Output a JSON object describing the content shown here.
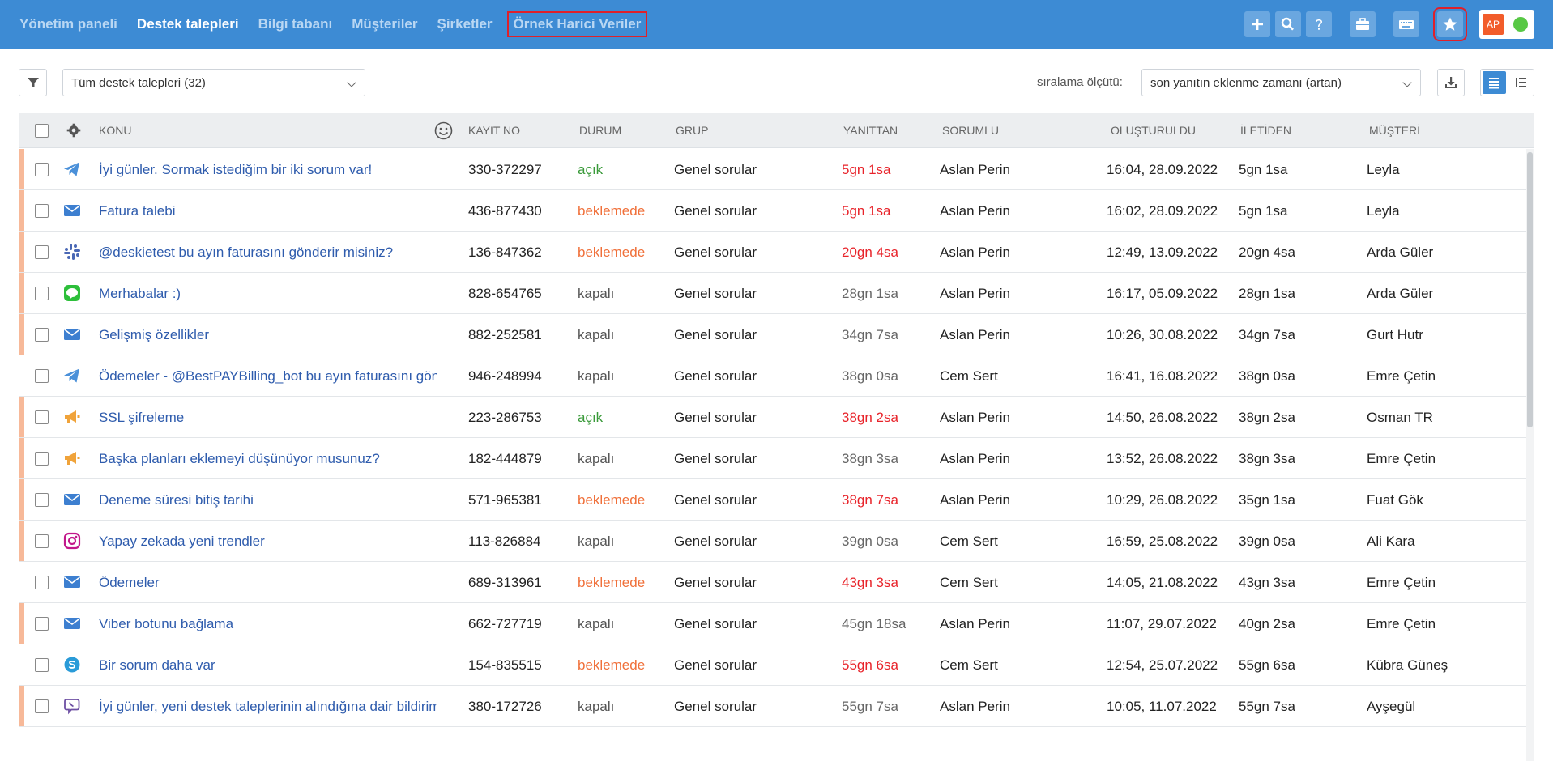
{
  "nav": {
    "items": [
      {
        "label": "Yönetim paneli",
        "active": false
      },
      {
        "label": "Destek talepleri",
        "active": true
      },
      {
        "label": "Bilgi tabanı",
        "active": false
      },
      {
        "label": "Müşteriler",
        "active": false
      },
      {
        "label": "Şirketler",
        "active": false
      },
      {
        "label": "Örnek Harici Veriler",
        "active": false,
        "highlighted": true
      }
    ]
  },
  "toolbar": {
    "icons": [
      "plus-icon",
      "search-icon",
      "help-icon",
      "briefcase-icon",
      "keyboard-icon",
      "star-icon"
    ],
    "avatar_initials": "AP",
    "online_color": "#58c845"
  },
  "filters": {
    "view_select": "Tüm destek talepleri (32)",
    "sort_label": "sıralama ölçütü:",
    "sort_select": "son yanıtın eklenme zamanı (artan)"
  },
  "table": {
    "headers": {
      "subject": "KONU",
      "id": "KAYIT NO",
      "status": "DURUM",
      "group": "GRUP",
      "reply": "YANITTAN",
      "assignee": "SORUMLU",
      "created": "OLUŞTURULDU",
      "fromMsg": "İLETİDEN",
      "customer": "MÜŞTERİ"
    },
    "rows": [
      {
        "channel": "telegram-icon",
        "accent": true,
        "subject": "İyi günler. Sormak istediğim bir iki sorum var!",
        "id": "330-372297",
        "status": "açık",
        "group": "Genel sorular",
        "reply": "5gn 1sa",
        "reply_overdue": true,
        "assignee": "Aslan Perin",
        "created": "16:04, 28.09.2022",
        "fromMsg": "5gn 1sa",
        "customer": "Leyla"
      },
      {
        "channel": "email-icon",
        "accent": true,
        "subject": "Fatura talebi",
        "id": "436-877430",
        "status": "beklemede",
        "group": "Genel sorular",
        "reply": "5gn 1sa",
        "reply_overdue": true,
        "assignee": "Aslan Perin",
        "created": "16:02, 28.09.2022",
        "fromMsg": "5gn 1sa",
        "customer": "Leyla"
      },
      {
        "channel": "slack-icon",
        "accent": true,
        "subject": "@deskietest bu ayın faturasını gönderir misiniz?",
        "id": "136-847362",
        "status": "beklemede",
        "group": "Genel sorular",
        "reply": "20gn 4sa",
        "reply_overdue": true,
        "assignee": "Aslan Perin",
        "created": "12:49, 13.09.2022",
        "fromMsg": "20gn 4sa",
        "customer": "Arda Güler"
      },
      {
        "channel": "line-icon",
        "accent": true,
        "subject": "Merhabalar :)",
        "id": "828-654765",
        "status": "kapalı",
        "group": "Genel sorular",
        "reply": "28gn 1sa",
        "reply_overdue": false,
        "assignee": "Aslan Perin",
        "created": "16:17, 05.09.2022",
        "fromMsg": "28gn 1sa",
        "customer": "Arda Güler"
      },
      {
        "channel": "email-icon",
        "accent": true,
        "subject": "Gelişmiş özellikler",
        "id": "882-252581",
        "status": "kapalı",
        "group": "Genel sorular",
        "reply": "34gn 7sa",
        "reply_overdue": false,
        "assignee": "Aslan Perin",
        "created": "10:26, 30.08.2022",
        "fromMsg": "34gn 7sa",
        "customer": "Gurt Hutr"
      },
      {
        "channel": "telegram-icon",
        "accent": false,
        "subject": "Ödemeler - @BestPAYBilling_bot bu ayın faturasını göndermedi",
        "id": "946-248994",
        "status": "kapalı",
        "group": "Genel sorular",
        "reply": "38gn 0sa",
        "reply_overdue": false,
        "assignee": "Cem Sert",
        "created": "16:41, 16.08.2022",
        "fromMsg": "38gn 0sa",
        "customer": "Emre Çetin"
      },
      {
        "channel": "megaphone-icon",
        "accent": true,
        "subject": "SSL şifreleme",
        "id": "223-286753",
        "status": "açık",
        "group": "Genel sorular",
        "reply": "38gn 2sa",
        "reply_overdue": true,
        "assignee": "Aslan Perin",
        "created": "14:50, 26.08.2022",
        "fromMsg": "38gn 2sa",
        "customer": "Osman TR"
      },
      {
        "channel": "megaphone-icon",
        "accent": true,
        "subject": "Başka planları eklemeyi düşünüyor musunuz?",
        "id": "182-444879",
        "status": "kapalı",
        "group": "Genel sorular",
        "reply": "38gn 3sa",
        "reply_overdue": false,
        "assignee": "Aslan Perin",
        "created": "13:52, 26.08.2022",
        "fromMsg": "38gn 3sa",
        "customer": "Emre Çetin"
      },
      {
        "channel": "email-icon",
        "accent": true,
        "subject": "Deneme süresi bitiş tarihi",
        "id": "571-965381",
        "status": "beklemede",
        "group": "Genel sorular",
        "reply": "38gn 7sa",
        "reply_overdue": true,
        "assignee": "Aslan Perin",
        "created": "10:29, 26.08.2022",
        "fromMsg": "35gn 1sa",
        "customer": "Fuat Gök"
      },
      {
        "channel": "instagram-icon",
        "accent": true,
        "subject": "Yapay zekada yeni trendler",
        "id": "113-826884",
        "status": "kapalı",
        "group": "Genel sorular",
        "reply": "39gn 0sa",
        "reply_overdue": false,
        "assignee": "Cem Sert",
        "created": "16:59, 25.08.2022",
        "fromMsg": "39gn 0sa",
        "customer": "Ali Kara"
      },
      {
        "channel": "email-icon",
        "accent": false,
        "subject": "Ödemeler",
        "id": "689-313961",
        "status": "beklemede",
        "group": "Genel sorular",
        "reply": "43gn 3sa",
        "reply_overdue": true,
        "assignee": "Cem Sert",
        "created": "14:05, 21.08.2022",
        "fromMsg": "43gn 3sa",
        "customer": "Emre Çetin"
      },
      {
        "channel": "email-icon",
        "accent": true,
        "subject": "Viber botunu bağlama",
        "id": "662-727719",
        "status": "kapalı",
        "group": "Genel sorular",
        "reply": "45gn 18sa",
        "reply_overdue": false,
        "assignee": "Aslan Perin",
        "created": "11:07, 29.07.2022",
        "fromMsg": "40gn 2sa",
        "customer": "Emre Çetin"
      },
      {
        "channel": "skype-icon",
        "accent": false,
        "subject": "Bir sorum daha var",
        "id": "154-835515",
        "status": "beklemede",
        "group": "Genel sorular",
        "reply": "55gn 6sa",
        "reply_overdue": true,
        "assignee": "Cem Sert",
        "created": "12:54, 25.07.2022",
        "fromMsg": "55gn 6sa",
        "customer": "Kübra Güneş"
      },
      {
        "channel": "viber-icon",
        "accent": true,
        "subject": "İyi günler, yeni destek taleplerinin alındığına dair bildirim",
        "id": "380-172726",
        "status": "kapalı",
        "group": "Genel sorular",
        "reply": "55gn 7sa",
        "reply_overdue": false,
        "assignee": "Aslan Perin",
        "created": "10:05, 11.07.2022",
        "fromMsg": "55gn 7sa",
        "customer": "Ayşegül"
      }
    ]
  },
  "colors": {
    "topbar": "#3d8bd4",
    "status_open": "#3a9a3a",
    "status_pending": "#f0703a",
    "status_closed": "#555555",
    "overdue": "#e8232a",
    "normal_time": "#666666",
    "link": "#2f5cad"
  }
}
